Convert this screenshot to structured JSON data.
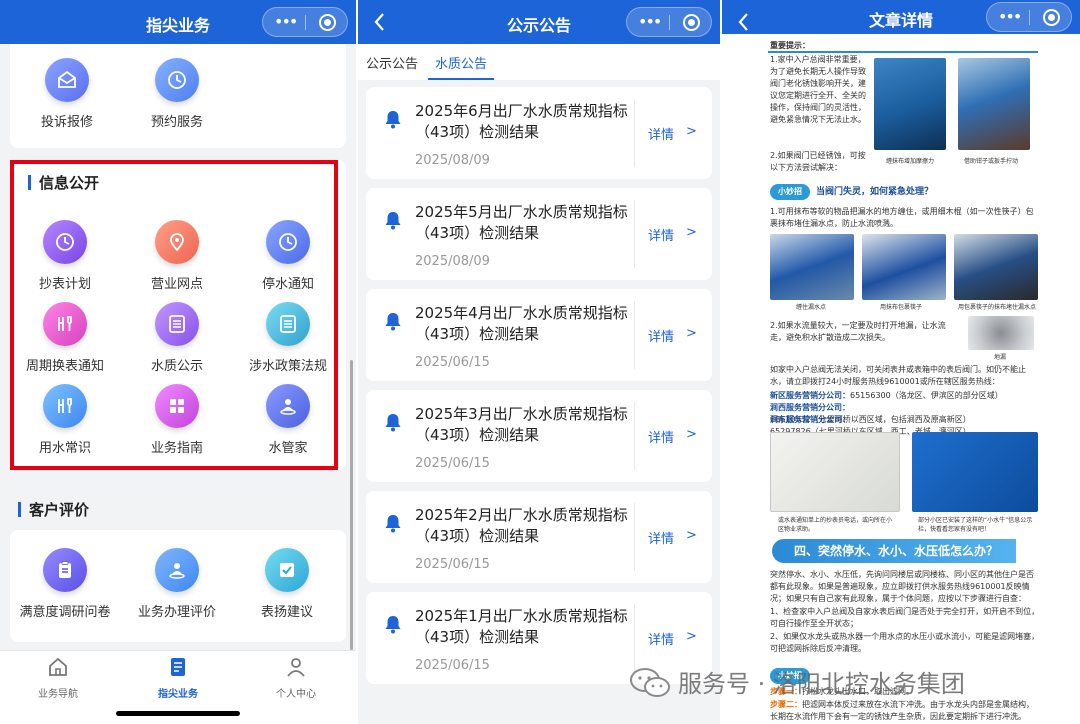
{
  "panel1": {
    "title": "指尖业务",
    "top_items": [
      {
        "label": "投诉报修",
        "icon": "envelope-icon",
        "color": "#6a7ff2"
      },
      {
        "label": "预约服务",
        "icon": "clock-icon",
        "color": "#5b8ff5"
      }
    ],
    "info_section": {
      "title": "信息公开",
      "items": [
        {
          "label": "抄表计划",
          "icon": "clock-icon",
          "color": "#8f54f0"
        },
        {
          "label": "营业网点",
          "icon": "location-pin-icon",
          "color": "#f27b67"
        },
        {
          "label": "停水通知",
          "icon": "clock-icon",
          "color": "#5b7ef3"
        },
        {
          "label": "周期换表通知",
          "icon": "tools-icon",
          "color": "#e85ad1"
        },
        {
          "label": "水质公示",
          "icon": "list-icon",
          "color": "#9a62f2"
        },
        {
          "label": "涉水政策法规",
          "icon": "list-icon",
          "color": "#3fb4d8"
        },
        {
          "label": "用水常识",
          "icon": "tools-icon",
          "color": "#4c9cf3"
        },
        {
          "label": "业务指南",
          "icon": "grid-icon",
          "color": "#d257e6"
        },
        {
          "label": "水管家",
          "icon": "person-icon",
          "color": "#5a72e8"
        }
      ]
    },
    "eval_section": {
      "title": "客户评价",
      "items": [
        {
          "label": "满意度调研问卷",
          "icon": "clipboard-icon",
          "color": "#6c62f0"
        },
        {
          "label": "业务办理评价",
          "icon": "person-icon",
          "color": "#4e9df5"
        },
        {
          "label": "表扬建议",
          "icon": "checkbox-icon",
          "color": "#41b7e0"
        }
      ]
    },
    "bottom_nav": [
      {
        "label": "业务导航",
        "icon": "home-icon",
        "active": false
      },
      {
        "label": "指尖业务",
        "icon": "document-icon",
        "active": true
      },
      {
        "label": "个人中心",
        "icon": "user-icon",
        "active": false
      }
    ]
  },
  "panel2": {
    "title": "公示公告",
    "tabs": [
      {
        "label": "公示公告",
        "active": false
      },
      {
        "label": "水质公告",
        "active": true
      }
    ],
    "detail_label": "详情",
    "chevron": ">",
    "notices": [
      {
        "title": "2025年6月出厂水水质常规指标（43项）检测结果",
        "date": "2025/08/09"
      },
      {
        "title": "2025年5月出厂水水质常规指标（43项）检测结果",
        "date": "2025/08/09"
      },
      {
        "title": "2025年4月出厂水水质常规指标（43项）检测结果",
        "date": "2025/06/15"
      },
      {
        "title": "2025年3月出厂水水质常规指标（43项）检测结果",
        "date": "2025/06/15"
      },
      {
        "title": "2025年2月出厂水水质常规指标（43项）检测结果",
        "date": "2025/06/15"
      },
      {
        "title": "2025年1月出厂水水质常规指标（43项）检测结果",
        "date": "2025/06/15"
      }
    ]
  },
  "panel3": {
    "title": "文章详情",
    "tip_label": "重要提示：",
    "tip_text": "1.家中入户总阀非常重要，为了避免长期无人操作导致阀门老化锈蚀影响开关，建议您定期进行全开、全关的操作，保持阀门的灵活性，避免紧急情况下无法止水。",
    "tip_text2": "2.如果阀门已经锈蚀，可按以下方法尝试解决：",
    "photo_caption1": "缠抹布增加摩擦力",
    "photo_caption2": "借助钳子或扳手拧动",
    "trick_badge": "小妙招",
    "trick_title": "当阀门失灵，如何紧急处理？",
    "trick_text1": "1.可用抹布等软的物品把漏水的地方缠住，或用细木棍（如一次性筷子）包裹抹布堵住漏水点，防止水流喷溅。",
    "photo_caption3": "缠住漏水点",
    "photo_caption4": "用抹布包裹筷子",
    "photo_caption5": "用包裹筷子的抹布堵住漏水点",
    "trick_text2": "2.如果水流量较大，一定要及时打开地漏，让水流走，避免积水扩散造成二次损失。",
    "photo_caption6": "地漏",
    "hotline_text": "如家中入户总阀无法关闭，可关闭表井或表箱中的表后阀门。如仍不能止水，请立即拨打24小时服务热线9610001或所在辖区服务热线：",
    "hotlines": [
      {
        "name": "新区服务营销分公司：",
        "number": "65156300（洛龙区、伊滨区的部分区域）"
      },
      {
        "name": "涧西服务营销分公司：",
        "number": "68610532（七里河桥以西区域，包括涧西及原高新区）"
      },
      {
        "name": "涧东服务营销分公司：",
        "number": "65297826（七里河桥以东区域，西工、老城、瀍河区）"
      }
    ],
    "photo_caption7": "或水表通知单上的抄表员电话，或向所在小区物业求助。",
    "photo_caption8": "部分小区已安装了这样的“小水牛”信息公示栏，快看看您家有没有吧！",
    "section4_title": "四、突然停水、水小、水压低怎么办？",
    "section4_text": "突然停水、水小、水压低，先询问同楼层或同楼栋、同小区的其他住户是否都有此现象。如果是普遍现象，应立即拨打供水服务热线9610001反映情况；如果只有自己家有此现象，属于个体问题，应按以下步骤进行自查：",
    "section4_step1": "1、检查家中入户总阀及自家水表后阀门是否处于完全打开，如开启不到位，可自行操作至全开状态；",
    "section4_step2": "2、如果仅水龙头或热水器一个用水点的水压小或水流小，可能是滤网堵塞，可把滤网拆除后反冲清理。",
    "step_a_label": "步骤一：",
    "step_a_text": "拧松水龙头出水口，取出滤网。",
    "step_b_label": "步骤二：",
    "step_b_text": "把滤网本体反过来放在水流下冲洗。由于水龙头内部是金属结构，长期在水流作用下会有一定的锈蚀产生杂质，因此要定期拆下进行冲洗。",
    "watermark": "服务号 · 洛阳北控水务集团"
  }
}
